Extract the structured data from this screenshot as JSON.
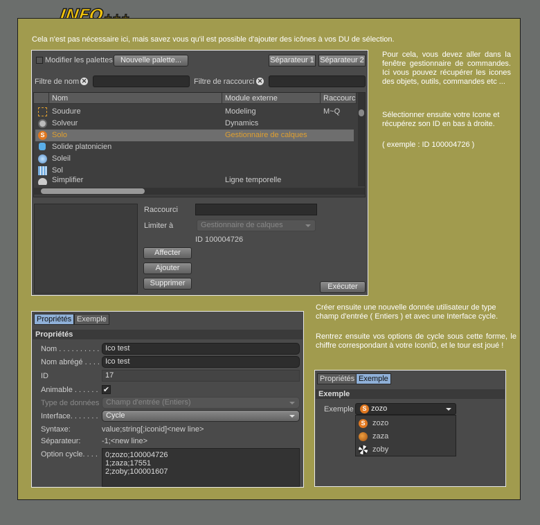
{
  "logo": {
    "text": "INFO",
    "plus": "+++"
  },
  "notes": {
    "top": "Cela n'est pas nécessaire ici, mais savez vous qu'il est possible d'ajouter des icônes à vos DU de sélection.",
    "right1": "Pour cela, vous devez aller dans la fenêtre gestionnaire de commandes. Ici vous pouvez récupérer les icones des objets, outils, commandes etc ...",
    "right2": "Sélectionner ensuite votre Icone et récupérez son ID en bas à droite.",
    "right3": "( exemple : ID 100004726 )",
    "mid1": "Créer ensuite une nouvelle donnée utilisateur de type champ d'entrée ( Entiers ) et avec une Interface cycle.",
    "mid2": "Rentrez ensuite vos options de cycle sous cette forme, le chiffre correspondant à votre IconID, et le tour est joué !"
  },
  "cmd": {
    "modify_palettes": "Modifier les palettes",
    "new_palette": "Nouvelle palette...",
    "sep1": "Séparateur 1",
    "sep2": "Séparateur 2",
    "filter_name": "Filtre de nom",
    "filter_shortcut": "Filtre de raccourci",
    "columns": [
      "Nom",
      "Module externe",
      "Raccourci"
    ],
    "rows": [
      {
        "name": "Soudure",
        "module": "Modeling",
        "shortcut": "M~Q",
        "icon": "weld-icon"
      },
      {
        "name": "Solveur",
        "module": "Dynamics",
        "shortcut": "",
        "icon": "gear-icon"
      },
      {
        "name": "Solo",
        "module": "Gestionnaire de calques",
        "shortcut": "",
        "icon": "solo-icon"
      },
      {
        "name": "Solide platonicien",
        "module": "",
        "shortcut": "",
        "icon": "platonic-icon"
      },
      {
        "name": "Soleil",
        "module": "",
        "shortcut": "",
        "icon": "sun-icon"
      },
      {
        "name": "Sol",
        "module": "",
        "shortcut": "",
        "icon": "floor-icon"
      },
      {
        "name": "Simplifier",
        "module": "Ligne temporelle",
        "shortcut": "",
        "icon": "simplify-icon"
      }
    ],
    "shortcut_label": "Raccourci",
    "limit_label": "Limiter à",
    "limit_value": "Gestionnaire de calques",
    "id_text": "ID 100004726",
    "assign": "Affecter",
    "add": "Ajouter",
    "delete": "Supprimer",
    "execute": "Exécuter"
  },
  "props": {
    "tabs": [
      "Propriétés",
      "Exemple"
    ],
    "section": "Propriétés",
    "name_label": "Nom . . . . . . . . . .",
    "name_value": "Ico test",
    "short_label": "Nom abrégé . . . .",
    "short_value": "Ico test",
    "id_label": "ID",
    "id_value": "17",
    "anim_label": "Animable . . . . . .",
    "anim_check": "✔",
    "type_label": "Type de données",
    "type_value": "Champ d'entrée (Entiers)",
    "iface_label": "Interface. . . . . . .",
    "iface_value": "Cycle",
    "syntax_label": "Syntaxe:",
    "syntax_value": "value;string[;iconid]<new line>",
    "sep_label": "Séparateur:",
    "sep_value": "-1;<new line>",
    "cycle_label": "Option cycle. . . .",
    "cycle_lines": [
      "0;zozo;100004726",
      "1;zaza;17551",
      "2;zoby;100001607"
    ]
  },
  "example": {
    "tabs": [
      "Propriétés",
      "Exemple"
    ],
    "section": "Exemple",
    "label": "Exemple",
    "selected": "zozo",
    "options": [
      "zozo",
      "zaza",
      "zoby"
    ]
  },
  "colors": {
    "accent": "#e0a030",
    "selected_row": "#6e6e6e",
    "frame": "#a19b4e"
  }
}
